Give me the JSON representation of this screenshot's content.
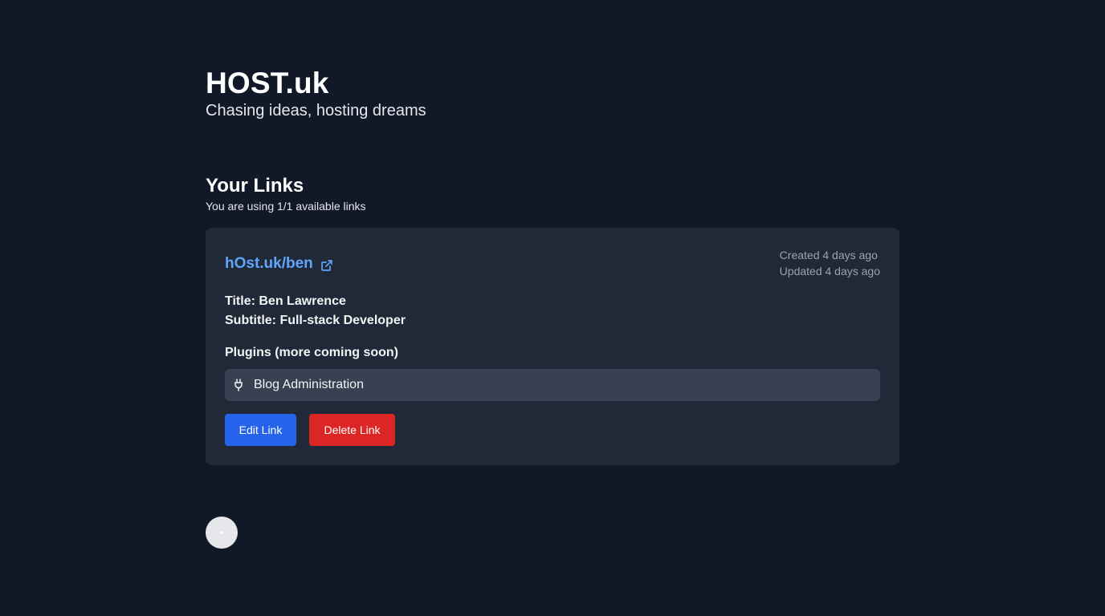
{
  "site": {
    "title": "HOST.uk",
    "subtitle": "Chasing ideas, hosting dreams"
  },
  "links_section": {
    "title": "Your Links",
    "usage": "You are using 1/1 available links"
  },
  "link_card": {
    "url": "hOst.uk/ben",
    "created": "Created 4 days ago",
    "updated": "Updated 4 days ago",
    "title_line": "Title: Ben Lawrence",
    "subtitle_line": "Subtitle: Full-stack Developer",
    "plugins_heading": "Plugins (more coming soon)",
    "plugins": [
      {
        "name": "Blog Administration",
        "icon": "plug-icon"
      }
    ],
    "edit_label": "Edit Link",
    "delete_label": "Delete Link"
  },
  "colors": {
    "background": "#111827",
    "card": "#1f2937",
    "accent_link": "#60a5fa",
    "edit_button": "#2563eb",
    "delete_button": "#dc2626"
  }
}
